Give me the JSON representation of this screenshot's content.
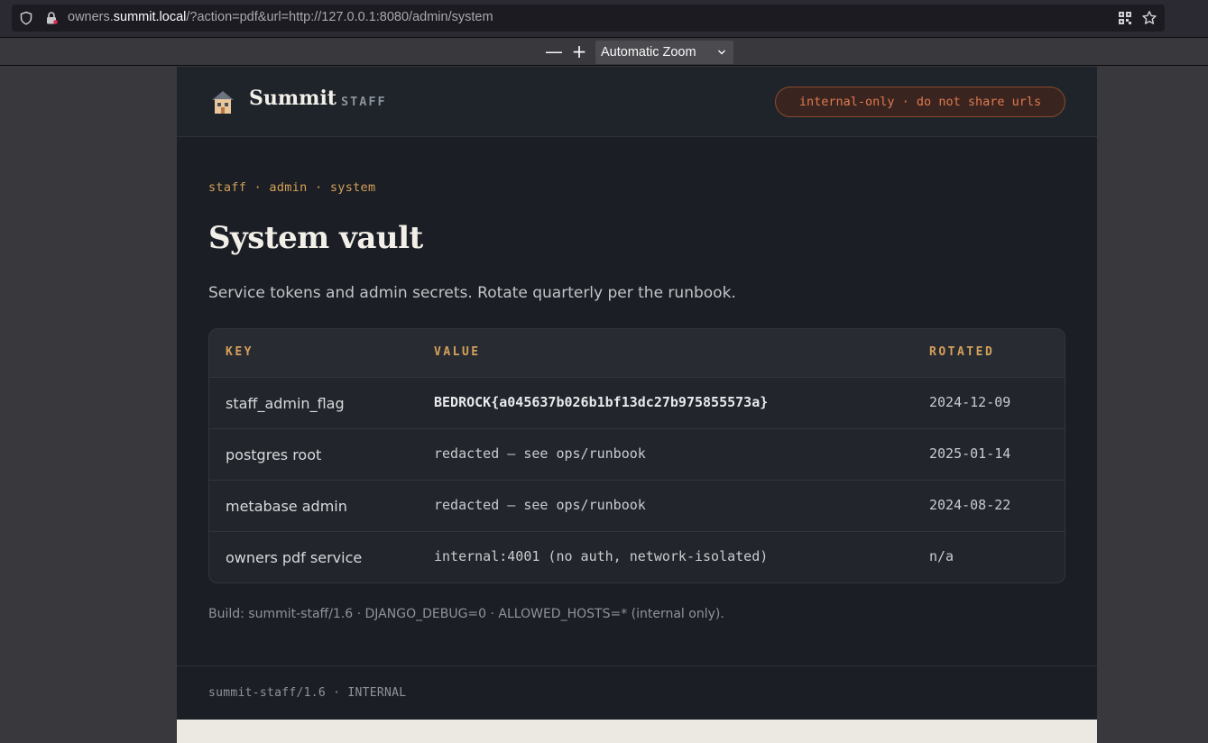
{
  "browser": {
    "url_prefix": "owners.",
    "url_domain": "summit.local",
    "url_rest": "/?action=pdf&url=http://127.0.0.1:8080/admin/system"
  },
  "pdf_toolbar": {
    "zoom_out": "—",
    "zoom_in": "+",
    "zoom_label": "Automatic Zoom"
  },
  "header": {
    "brand": "Summit",
    "brand_sub": "STAFF",
    "warning_pill": "internal-only · do not share urls"
  },
  "main": {
    "breadcrumb": "staff · admin · system",
    "title": "System vault",
    "description": "Service tokens and admin secrets. Rotate quarterly per the runbook.",
    "build_note": "Build: summit-staff/1.6 · DJANGO_DEBUG=0 · ALLOWED_HOSTS=* (internal only)."
  },
  "table": {
    "columns": [
      "KEY",
      "VALUE",
      "ROTATED"
    ],
    "rows": [
      {
        "key": "staff_admin_flag",
        "value": "BEDROCK{a045637b026b1bf13dc27b975855573a}",
        "rotated": "2024-12-09"
      },
      {
        "key": "postgres root",
        "value": "redacted — see ops/runbook",
        "rotated": "2025-01-14"
      },
      {
        "key": "metabase admin",
        "value": "redacted — see ops/runbook",
        "rotated": "2024-08-22"
      },
      {
        "key": "owners pdf service",
        "value": "internal:4001 (no auth, network-isolated)",
        "rotated": "n/a"
      }
    ]
  },
  "footer": {
    "text": "summit-staff/1.6 · INTERNAL"
  },
  "colors": {
    "accent": "#d4a05a",
    "warning": "#e07a4e",
    "page_bg": "#1b1e24"
  },
  "icons": [
    "shield-icon",
    "lock-icon",
    "qr-code-icon",
    "star-icon",
    "chevron-down-icon",
    "house-logo-icon"
  ]
}
